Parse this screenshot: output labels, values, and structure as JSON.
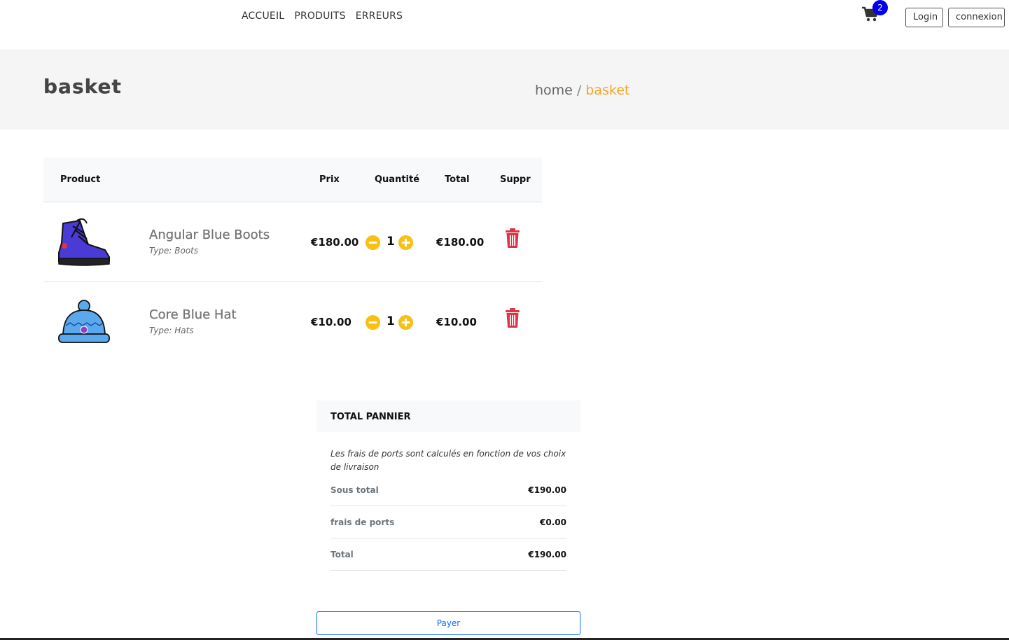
{
  "nav": {
    "links": [
      "ACCUEIL",
      "PRODUITS",
      "ERREURS"
    ],
    "cart_count": "2",
    "login_label": "Login",
    "connexion_label": "connexion"
  },
  "hero": {
    "title": "basket",
    "breadcrumb_home": "home",
    "breadcrumb_sep": "/",
    "breadcrumb_current": "basket"
  },
  "table": {
    "headers": {
      "product": "Product",
      "price": "Prix",
      "quantity": "Quantité",
      "total": "Total",
      "remove": "Suppr"
    },
    "rows": [
      {
        "name": "Angular Blue Boots",
        "type": "Type: Boots",
        "price": "€180.00",
        "qty": "1",
        "total": "€180.00",
        "icon": "blue-boot-image"
      },
      {
        "name": "Core Blue Hat",
        "type": "Type: Hats",
        "price": "€10.00",
        "qty": "1",
        "total": "€10.00",
        "icon": "blue-hat-image"
      }
    ]
  },
  "summary": {
    "title": "TOTAL PANNIER",
    "note": "Les frais de ports sont calculés en fonction de vos choix de livraison",
    "subtotal_label": "Sous total",
    "subtotal_value": "€190.00",
    "shipping_label": "frais de ports",
    "shipping_value": "€0.00",
    "total_label": "Total",
    "total_value": "€190.00"
  },
  "pay_label": "Payer",
  "colors": {
    "accent": "#f5a623",
    "badge": "#0000ee",
    "qty_button": "#f9c013",
    "trash": "#dc3545",
    "pay": "#0d6efd"
  }
}
